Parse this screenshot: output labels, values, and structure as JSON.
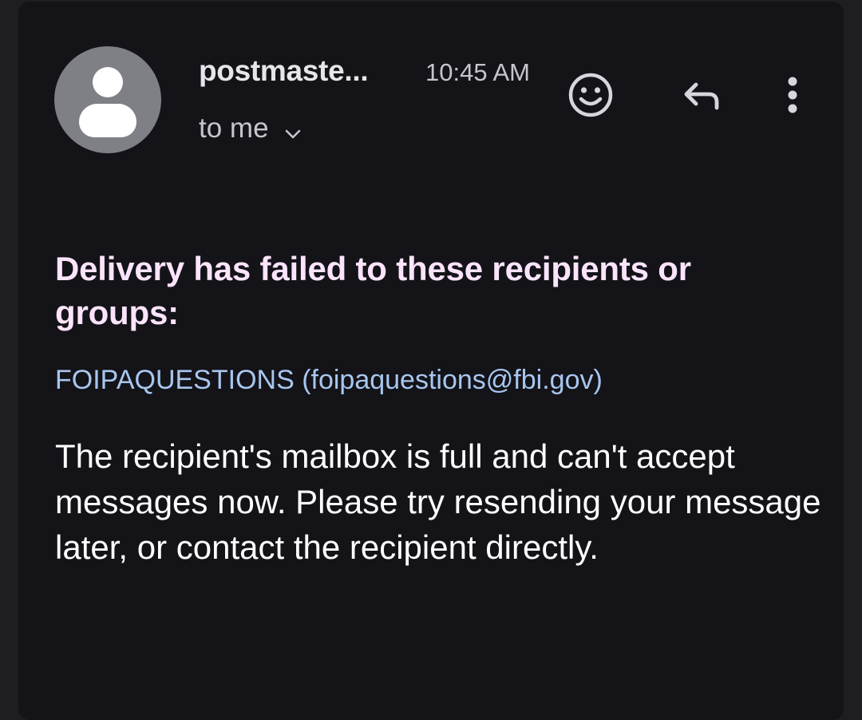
{
  "email": {
    "sender": "postmaste...",
    "time": "10:45 AM",
    "recipient_line": "to me",
    "heading": "Delivery has failed to these recipients or groups:",
    "failed_recipient": "FOIPAQUESTIONS (foipaquestions@fbi.gov)",
    "message": "The recipient's mailbox is full and can't accept messages now. Please try resending your message later, or contact the recipient directly."
  },
  "icons": {
    "avatar": "person-avatar-icon",
    "expand": "chevron-down-icon",
    "emoji": "emoji-smile-icon",
    "reply": "reply-icon",
    "more": "more-vertical-icon"
  },
  "colors": {
    "background": "#131318",
    "heading": "#fbe4fb",
    "link": "#a8c6ee",
    "body_text": "#ffffff",
    "avatar": "#7e8086"
  }
}
